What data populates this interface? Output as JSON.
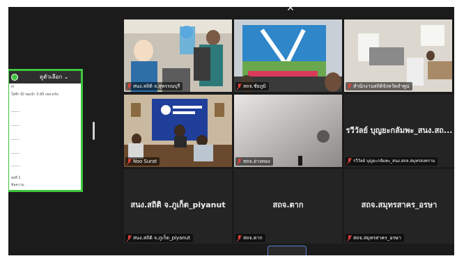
{
  "side_panel": {
    "header_label": "ดูตัวเลือก ⌄",
    "lines": [
      "rt",
      "ใส่ฟ้า ID ขอเข้า 3.95 เทส ครับ",
      "ส่งที่ 1",
      "ข้อความ"
    ]
  },
  "tiles": [
    {
      "name": "สนง.สถิติ จ.สุพรรณบุรี"
    },
    {
      "name": "สถจ.ชัยภูมิ"
    },
    {
      "name": "สำนักงานสถิติจังหวัดลำพูน"
    },
    {
      "name": "Nso Surat"
    },
    {
      "name": "สถจ.อ่างทอง"
    },
    {
      "name": "รวีวัลย์ บุญยะกลัมพะ_สนง.สถ...",
      "tag": "รวีวัลย์ บุญยะกลัมพะ_สนง.สถจ.สมุทรสงคราม"
    },
    {
      "name": "สนง.สถิติ จ.ภูเก็ต_piyanut",
      "tag": "สนง.สถิติ จ.ภูเก็ต_piyanut"
    },
    {
      "name": "สถจ.ตาก",
      "tag": "สถจ.ตาก"
    },
    {
      "name": "สถจ.สมุทรสาคร_อรษา",
      "tag": "สถจ.สมุทรสาคร_อรษา"
    }
  ],
  "colors": {
    "active_speaker": "#3cc63c",
    "muted": "#e0413a",
    "button_border": "#5a7fd0"
  },
  "icons": {
    "top_chevron": "chevron-up-icon",
    "bottom": "chevron-down-icon",
    "mic": "microphone-muted-icon"
  }
}
